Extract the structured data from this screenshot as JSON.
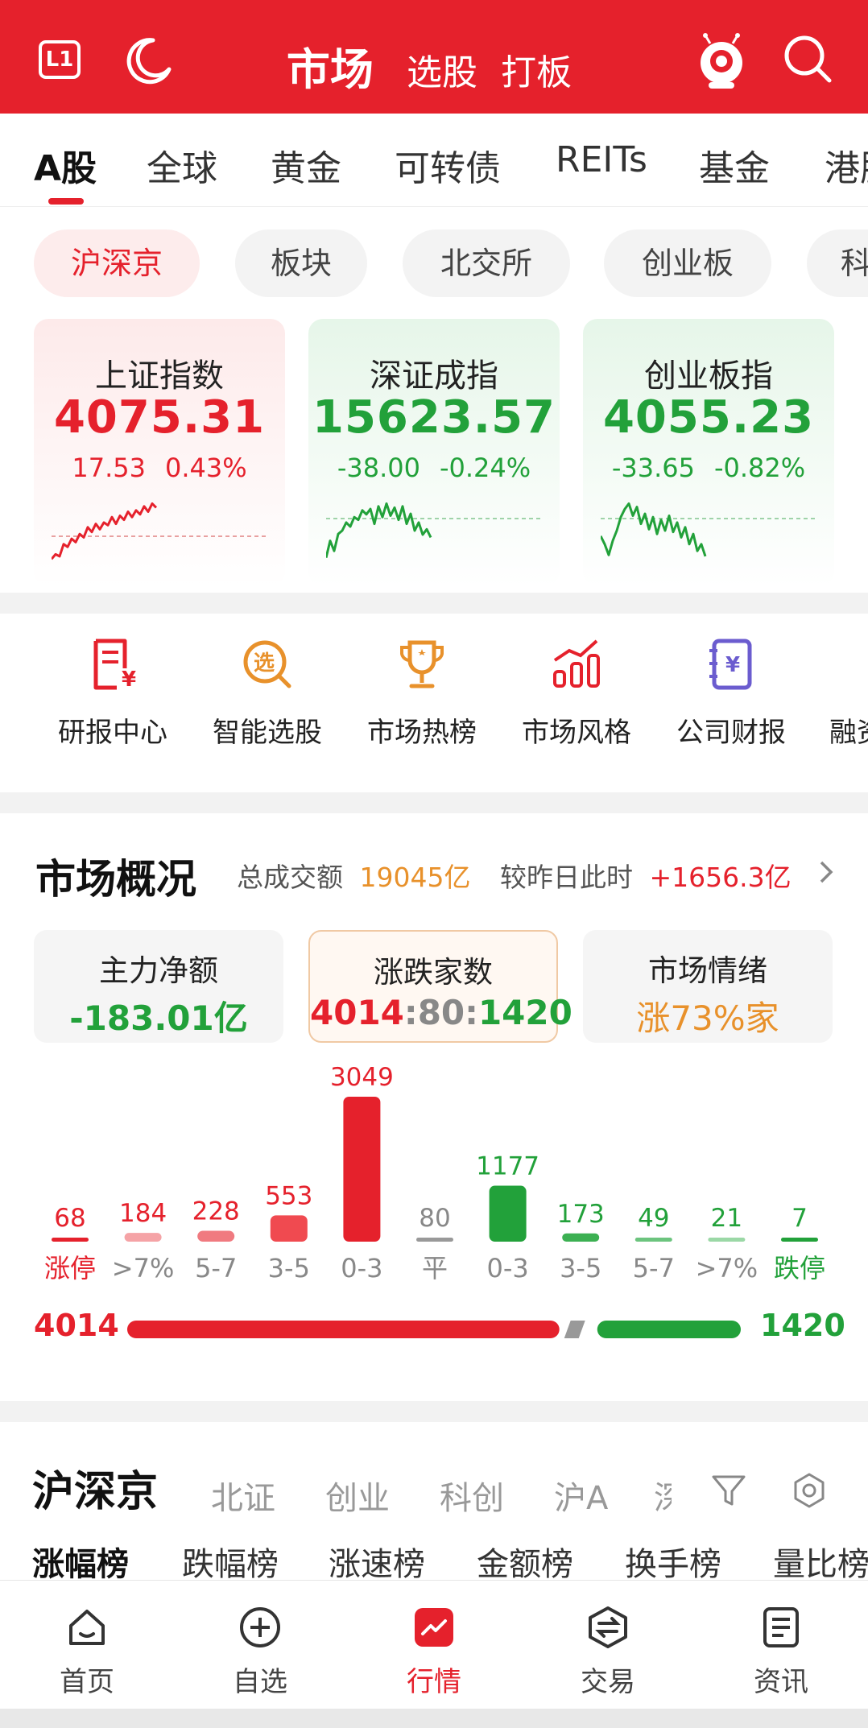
{
  "header": {
    "level_badge": "L1",
    "title": "市场",
    "tabs": [
      "选股",
      "打板"
    ],
    "icons": [
      "level-badge-icon",
      "moon-icon",
      "mascot-icon",
      "search-icon"
    ]
  },
  "market_tabs": [
    "A股",
    "全球",
    "黄金",
    "可转债",
    "REITs",
    "基金",
    "港股"
  ],
  "sub_tabs": [
    "沪深京",
    "板块",
    "北交所",
    "创业板",
    "科创板"
  ],
  "indices": [
    {
      "name": "上证指数",
      "value": "4075.31",
      "change": "17.53",
      "pct": "0.43%",
      "trend": "up",
      "spark": [
        0.08,
        0.15,
        0.12,
        0.3,
        0.26,
        0.38,
        0.33,
        0.45,
        0.4,
        0.55,
        0.48,
        0.6,
        0.52,
        0.62,
        0.58,
        0.7,
        0.6,
        0.72,
        0.66,
        0.78,
        0.7,
        0.8,
        0.74,
        0.86,
        0.78,
        0.9,
        0.84
      ]
    },
    {
      "name": "深证成指",
      "value": "15623.57",
      "change": "-38.00",
      "pct": "-0.24%",
      "trend": "down",
      "spark": [
        0.1,
        0.35,
        0.2,
        0.45,
        0.5,
        0.62,
        0.56,
        0.7,
        0.66,
        0.8,
        0.74,
        0.82,
        0.6,
        0.86,
        0.7,
        0.9,
        0.72,
        0.84,
        0.66,
        0.86,
        0.6,
        0.75,
        0.5,
        0.62,
        0.44,
        0.52,
        0.4
      ]
    },
    {
      "name": "创业板指",
      "value": "4055.23",
      "change": "-33.65",
      "pct": "-0.82%",
      "trend": "down",
      "spark": [
        0.42,
        0.3,
        0.14,
        0.35,
        0.5,
        0.7,
        0.82,
        0.9,
        0.72,
        0.85,
        0.6,
        0.75,
        0.52,
        0.7,
        0.45,
        0.66,
        0.5,
        0.72,
        0.48,
        0.62,
        0.4,
        0.55,
        0.3,
        0.45,
        0.2,
        0.3,
        0.12
      ]
    }
  ],
  "tools": [
    {
      "label": "研报中心",
      "icon": "report-icon",
      "color": "#e5212c"
    },
    {
      "label": "智能选股",
      "icon": "stock-picker-icon",
      "color": "#e8912b"
    },
    {
      "label": "市场热榜",
      "icon": "trophy-icon",
      "color": "#e8912b"
    },
    {
      "label": "市场风格",
      "icon": "bar-chart-icon",
      "color": "#e5212c"
    },
    {
      "label": "公司财报",
      "icon": "financial-report-icon",
      "color": "#6b5ccf"
    },
    {
      "label": "融资",
      "icon": "finance-icon",
      "color": "#e5212c"
    }
  ],
  "market_overview": {
    "title": "市场概况",
    "total_label": "总成交额",
    "total_value": "19045亿",
    "compare_label": "较昨日此时",
    "compare_value": "+1656.3亿",
    "cards": [
      {
        "title": "主力净额",
        "value": "-183.01亿",
        "color": "#22a13a"
      },
      {
        "title": "涨跌家数",
        "value": "4014:80:1420",
        "color": "#e5212c"
      },
      {
        "title": "市场情绪",
        "value": "涨73%家",
        "color": "#e8912b"
      }
    ]
  },
  "chart_data": {
    "type": "bar",
    "categories": [
      "涨停",
      ">7%",
      "5-7",
      "3-5",
      "0-3",
      "平",
      "0-3",
      "3-5",
      "5-7",
      ">7%",
      "跌停"
    ],
    "values": [
      68,
      184,
      228,
      553,
      3049,
      80,
      1177,
      173,
      49,
      21,
      7
    ],
    "colors": [
      "#e5212c",
      "#f5a3a6",
      "#f07a80",
      "#f04a50",
      "#e5212c",
      "#999999",
      "#22a13a",
      "#3cb052",
      "#6cc47e",
      "#9bd8a6",
      "#22a13a"
    ],
    "value_colors": [
      "#e5212c",
      "#e5212c",
      "#e5212c",
      "#e5212c",
      "#e5212c",
      "#888888",
      "#22a13a",
      "#22a13a",
      "#22a13a",
      "#22a13a",
      "#22a13a"
    ],
    "label_colors": [
      "#e5212c",
      "#888888",
      "#888888",
      "#888888",
      "#888888",
      "#888888",
      "#888888",
      "#888888",
      "#888888",
      "#888888",
      "#22a13a"
    ],
    "ylim": [
      0,
      3049
    ]
  },
  "distribution": {
    "up": 4014,
    "flat": 80,
    "down": 1420
  },
  "list_section": {
    "title": "沪深京",
    "tabs": [
      "北证",
      "创业",
      "科创",
      "沪A",
      "深"
    ],
    "subtabs": [
      "涨幅榜",
      "跌幅榜",
      "涨速榜",
      "金额榜",
      "换手榜",
      "量比榜"
    ]
  },
  "bottom_nav": [
    {
      "label": "首页",
      "icon": "home-icon"
    },
    {
      "label": "自选",
      "icon": "add-watchlist-icon"
    },
    {
      "label": "行情",
      "icon": "market-icon",
      "active": true
    },
    {
      "label": "交易",
      "icon": "trade-icon"
    },
    {
      "label": "资讯",
      "icon": "news-icon"
    }
  ]
}
